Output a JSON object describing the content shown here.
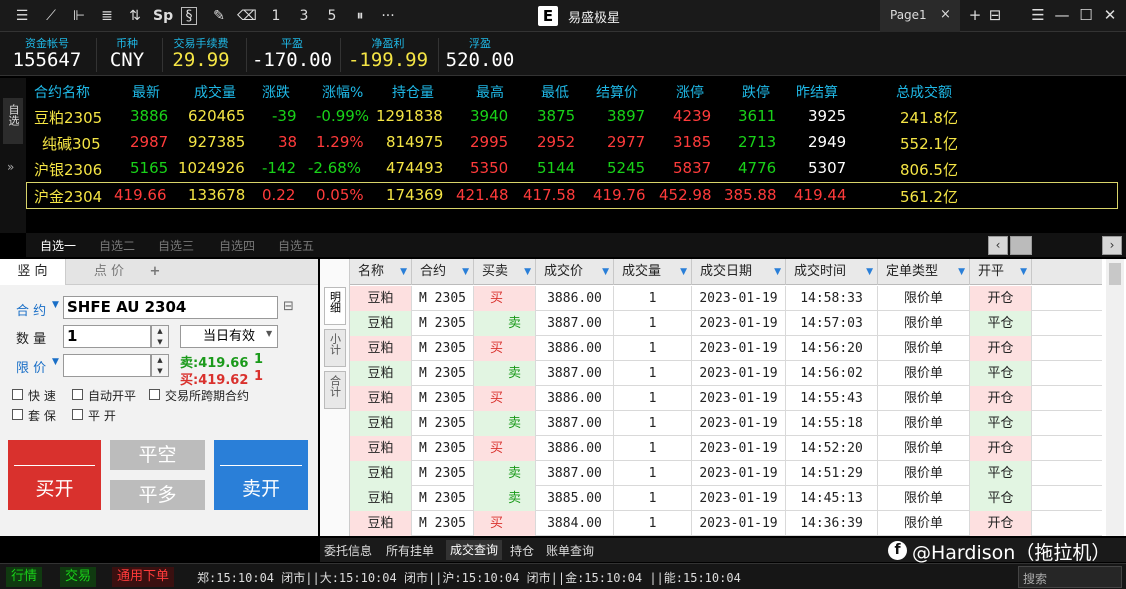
{
  "app": {
    "title": "易盛极星",
    "logo": "E",
    "page_tab": "Page1"
  },
  "toolbar": {
    "icons": [
      "menu-list-icon",
      "line-chart-icon",
      "candlestick-icon",
      "bar-list-icon",
      "trend-icon",
      "sp-icon",
      "script-icon",
      "pencil-icon",
      "eraser-icon",
      "digit-1-icon",
      "digit-3-icon",
      "digit-5-icon",
      "digit-10-icon",
      "more-icon"
    ],
    "sp_label": "Sp",
    "d1": "1",
    "d3": "3",
    "d5": "5",
    "more": "···"
  },
  "account": {
    "fund_account_label": "资金帐号",
    "fund_account": "155647",
    "currency_label": "币种",
    "currency": "CNY",
    "fee_label": "交易手续费",
    "fee": "29.99",
    "flat_pnl_label": "平盈",
    "flat_pnl": "-170.00",
    "net_profit_label": "净盈利",
    "net_profit": "-199.99",
    "float_pnl_label": "浮盈",
    "float_pnl": "520.00"
  },
  "watchlist_side": "自选",
  "quote_headers": [
    "合约名称",
    "最新",
    "成交量",
    "涨跌",
    "涨幅%",
    "持仓量",
    "最高",
    "最低",
    "结算价",
    "涨停",
    "跌停",
    "昨结算",
    "总成交额"
  ],
  "quotes": [
    {
      "name": "豆粕2305",
      "last": "3886",
      "volume": "620465",
      "change": "-39",
      "change_pct": "-0.99%",
      "open_int": "1291838",
      "high": "3940",
      "low": "3875",
      "settle": "3897",
      "limit_up": "4239",
      "limit_down": "3611",
      "prev_settle": "3925",
      "turnover": "241.8亿"
    },
    {
      "name": "纯碱305",
      "last": "2987",
      "volume": "927385",
      "change": "38",
      "change_pct": "1.29%",
      "open_int": "814975",
      "high": "2995",
      "low": "2952",
      "settle": "2977",
      "limit_up": "3185",
      "limit_down": "2713",
      "prev_settle": "2949",
      "turnover": "552.1亿"
    },
    {
      "name": "沪银2306",
      "last": "5165",
      "volume": "1024926",
      "change": "-142",
      "change_pct": "-2.68%",
      "open_int": "474493",
      "high": "5350",
      "low": "5144",
      "settle": "5245",
      "limit_up": "5837",
      "limit_down": "4776",
      "prev_settle": "5307",
      "turnover": "806.5亿"
    },
    {
      "name": "沪金2304",
      "last": "419.66",
      "volume": "133678",
      "change": "0.22",
      "change_pct": "0.05%",
      "open_int": "174369",
      "high": "421.48",
      "low": "417.58",
      "settle": "419.76",
      "limit_up": "452.98",
      "limit_down": "385.88",
      "prev_settle": "419.44",
      "turnover": "561.2亿"
    }
  ],
  "watch_tabs": [
    "自选一",
    "自选二",
    "自选三",
    "自选四",
    "自选五"
  ],
  "order": {
    "tabs": [
      "竖 向",
      "点 价"
    ],
    "add_tab": "+",
    "contract_label": "合 约",
    "contract": "SHFE AU 2304",
    "qty_label": "数 量",
    "qty": "1",
    "validity": "当日有效",
    "price_label": "限 价",
    "sell_quote": "卖:419.66",
    "sell_qty": "1",
    "buy_quote": "买:419.62",
    "buy_qty": "1",
    "options": [
      "快 速",
      "自动开平",
      "交易所跨期合约",
      "套 保",
      "平 开"
    ],
    "btn_buy_open": "买开",
    "btn_close_short": "平空",
    "btn_close_long": "平多",
    "btn_sell_open": "卖开"
  },
  "trade_side_tabs": [
    "明细",
    "小计",
    "合计"
  ],
  "trade_headers": [
    "名称",
    "合约",
    "买卖",
    "成交价",
    "成交量",
    "成交日期",
    "成交时间",
    "定单类型",
    "开平"
  ],
  "trades": [
    {
      "name": "豆粕",
      "contract": "M 2305",
      "side": "买",
      "price": "3886.00",
      "qty": "1",
      "date": "2023-01-19",
      "time": "14:58:33",
      "type": "限价单",
      "oc": "开仓"
    },
    {
      "name": "豆粕",
      "contract": "M 2305",
      "side": "卖",
      "price": "3887.00",
      "qty": "1",
      "date": "2023-01-19",
      "time": "14:57:03",
      "type": "限价单",
      "oc": "平仓"
    },
    {
      "name": "豆粕",
      "contract": "M 2305",
      "side": "买",
      "price": "3886.00",
      "qty": "1",
      "date": "2023-01-19",
      "time": "14:56:20",
      "type": "限价单",
      "oc": "开仓"
    },
    {
      "name": "豆粕",
      "contract": "M 2305",
      "side": "卖",
      "price": "3887.00",
      "qty": "1",
      "date": "2023-01-19",
      "time": "14:56:02",
      "type": "限价单",
      "oc": "平仓"
    },
    {
      "name": "豆粕",
      "contract": "M 2305",
      "side": "买",
      "price": "3886.00",
      "qty": "1",
      "date": "2023-01-19",
      "time": "14:55:43",
      "type": "限价单",
      "oc": "开仓"
    },
    {
      "name": "豆粕",
      "contract": "M 2305",
      "side": "卖",
      "price": "3887.00",
      "qty": "1",
      "date": "2023-01-19",
      "time": "14:55:18",
      "type": "限价单",
      "oc": "平仓"
    },
    {
      "name": "豆粕",
      "contract": "M 2305",
      "side": "买",
      "price": "3886.00",
      "qty": "1",
      "date": "2023-01-19",
      "time": "14:52:20",
      "type": "限价单",
      "oc": "开仓"
    },
    {
      "name": "豆粕",
      "contract": "M 2305",
      "side": "卖",
      "price": "3887.00",
      "qty": "1",
      "date": "2023-01-19",
      "time": "14:51:29",
      "type": "限价单",
      "oc": "平仓"
    },
    {
      "name": "豆粕",
      "contract": "M 2305",
      "side": "卖",
      "price": "3885.00",
      "qty": "1",
      "date": "2023-01-19",
      "time": "14:45:13",
      "type": "限价单",
      "oc": "平仓"
    },
    {
      "name": "豆粕",
      "contract": "M 2305",
      "side": "买",
      "price": "3884.00",
      "qty": "1",
      "date": "2023-01-19",
      "time": "14:36:39",
      "type": "限价单",
      "oc": "开仓"
    }
  ],
  "bottom_tabs": [
    "委托信息",
    "所有挂单",
    "成交查询",
    "持仓",
    "账单查询"
  ],
  "watermark": "@Hardison（拖拉机）",
  "watermark_icon": "f",
  "status": {
    "market": "行情",
    "trade": "交易",
    "general_order": "通用下单",
    "exchange_times": "郑:15:10:04 闭市||大:15:10:04 闭市||沪:15:10:04 闭市||金:15:10:04 ||能:15:10:04",
    "search_placeholder": "搜索"
  },
  "colors": {
    "up": "#ff3b3b",
    "down": "#19d219",
    "header": "#1fb8e6",
    "name": "#f5e545",
    "buy_bg": "#fde0e0",
    "sell_bg": "#e2f5e2"
  }
}
